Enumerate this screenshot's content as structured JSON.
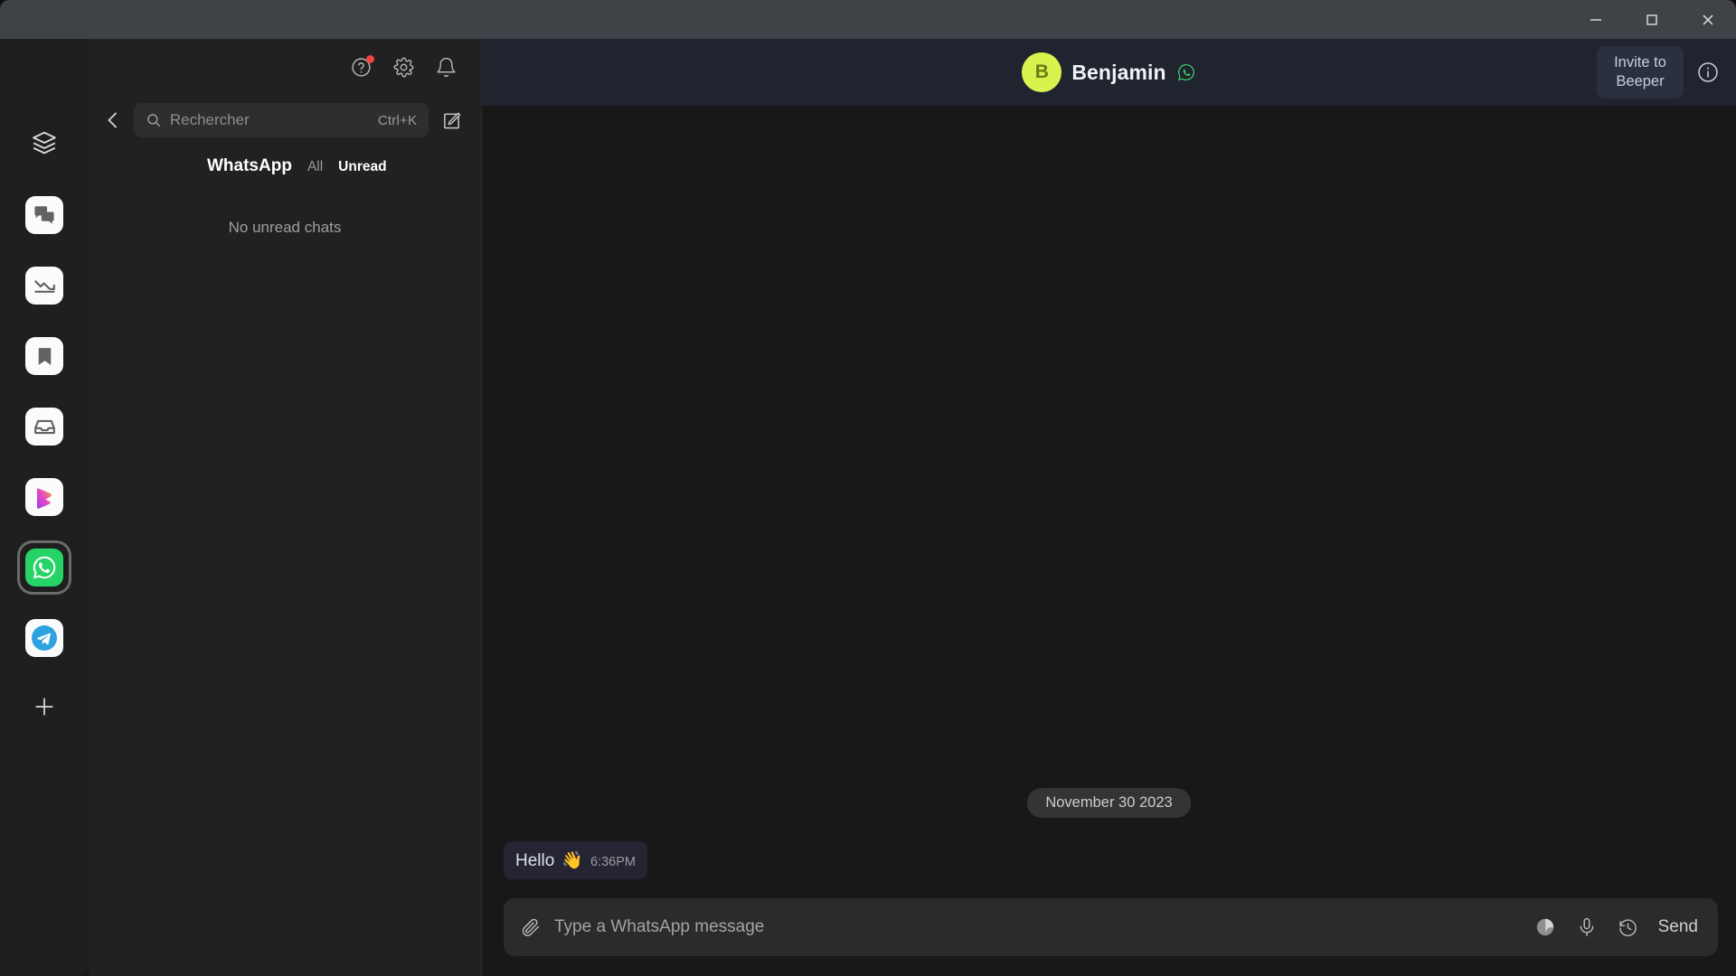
{
  "window": {
    "minimize_label": "Minimize",
    "maximize_label": "Maximize",
    "close_label": "Close"
  },
  "colors": {
    "titlebar": "#3f4247",
    "rail": "#1f1f1f",
    "list_panel": "#212121",
    "chat_pane": "#181818",
    "chat_header": "#20242f",
    "accent_whatsapp": "#25d366",
    "accent_telegram": "#2fa3e0",
    "avatar_bg": "#d9f24e",
    "badge_red": "#f0453e",
    "bubble": "#242433",
    "invite_button": "#2b3040"
  },
  "rail": {
    "items": [
      {
        "name": "all-inboxes",
        "icon": "layers-icon",
        "label": "All Inboxes",
        "selected": false,
        "kind": "plain"
      },
      {
        "name": "chats",
        "icon": "chat-bubbles-icon",
        "label": "Chats",
        "selected": false,
        "kind": "tile"
      },
      {
        "name": "low-priority",
        "icon": "trending-down-icon",
        "label": "Low Priority",
        "selected": false,
        "kind": "tile"
      },
      {
        "name": "saved",
        "icon": "bookmark-icon",
        "label": "Saved",
        "selected": false,
        "kind": "tile"
      },
      {
        "name": "archive",
        "icon": "inbox-tray-icon",
        "label": "Archive",
        "selected": false,
        "kind": "tile"
      },
      {
        "name": "beeper",
        "icon": "beeper-logo-icon",
        "label": "Beeper",
        "selected": false,
        "kind": "tile"
      },
      {
        "name": "whatsapp",
        "icon": "whatsapp-icon",
        "label": "WhatsApp",
        "selected": true,
        "kind": "tile"
      },
      {
        "name": "telegram",
        "icon": "telegram-icon",
        "label": "Telegram",
        "selected": false,
        "kind": "tile"
      },
      {
        "name": "add-account",
        "icon": "plus-icon",
        "label": "Add account",
        "selected": false,
        "kind": "plain"
      }
    ]
  },
  "list_panel": {
    "top_icons": [
      {
        "name": "help-icon",
        "label": "Help",
        "badge": true
      },
      {
        "name": "gear-icon",
        "label": "Settings",
        "badge": false
      },
      {
        "name": "bell-icon",
        "label": "Notifications",
        "badge": false
      }
    ],
    "back_label": "Back",
    "search": {
      "placeholder": "Rechercher",
      "value": "",
      "shortcut": "Ctrl+K"
    },
    "compose_label": "New chat",
    "header_title": "WhatsApp",
    "tabs": [
      {
        "label": "All",
        "active": false
      },
      {
        "label": "Unread",
        "active": true
      }
    ],
    "empty_state": "No unread chats"
  },
  "chat": {
    "avatar_initial": "B",
    "name": "Benjamin",
    "network_icon": "whatsapp-icon",
    "invite_button": "Invite to Beeper",
    "info_label": "Chat info",
    "date_separator": "November 30 2023",
    "messages": [
      {
        "text": "Hello",
        "emoji": "👋",
        "time": "6:36PM",
        "side": "incoming"
      }
    ],
    "composer": {
      "attach_label": "Attach file",
      "placeholder": "Type a WhatsApp message",
      "value": "",
      "sticker_label": "Stickers",
      "mic_label": "Voice message",
      "schedule_label": "Send later",
      "send_label": "Send"
    }
  }
}
